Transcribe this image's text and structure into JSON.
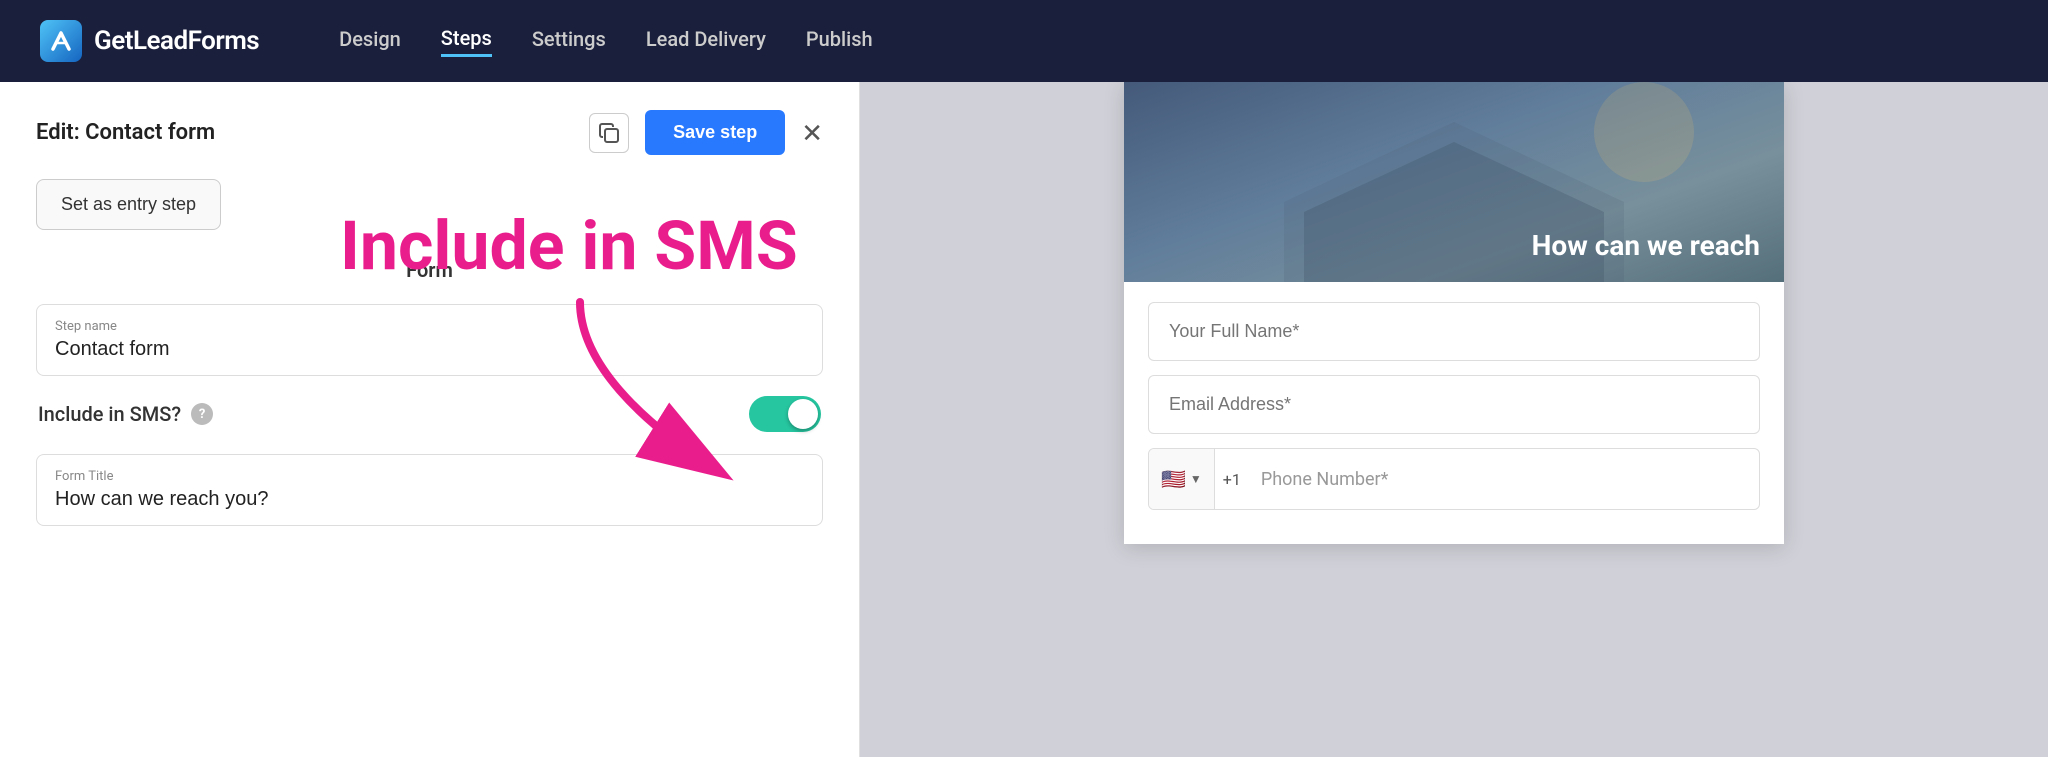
{
  "header": {
    "logo_text": "GetLeadForms",
    "nav_items": [
      {
        "label": "Design",
        "active": false
      },
      {
        "label": "Steps",
        "active": true
      },
      {
        "label": "Settings",
        "active": false
      },
      {
        "label": "Lead Delivery",
        "active": false
      },
      {
        "label": "Publish",
        "active": false
      }
    ]
  },
  "left_panel": {
    "title": "Edit: Contact form",
    "save_step_label": "Save step",
    "entry_step_label": "Set as entry step",
    "section_label": "Form",
    "step_name_label": "Step name",
    "step_name_value": "Contact form",
    "include_sms_label": "Include in SMS?",
    "help_icon_label": "?",
    "form_title_label": "Form Title",
    "form_title_value": "How can we reach you?"
  },
  "annotation": {
    "text": "Include in SMS"
  },
  "right_panel": {
    "header_title": "How can we reach",
    "full_name_placeholder": "Your Full Name*",
    "email_placeholder": "Email Address*",
    "phone_placeholder": "Phone Number*",
    "phone_code": "+1",
    "flag": "🇺🇸"
  },
  "icons": {
    "copy": "⊞",
    "close": "✕"
  }
}
